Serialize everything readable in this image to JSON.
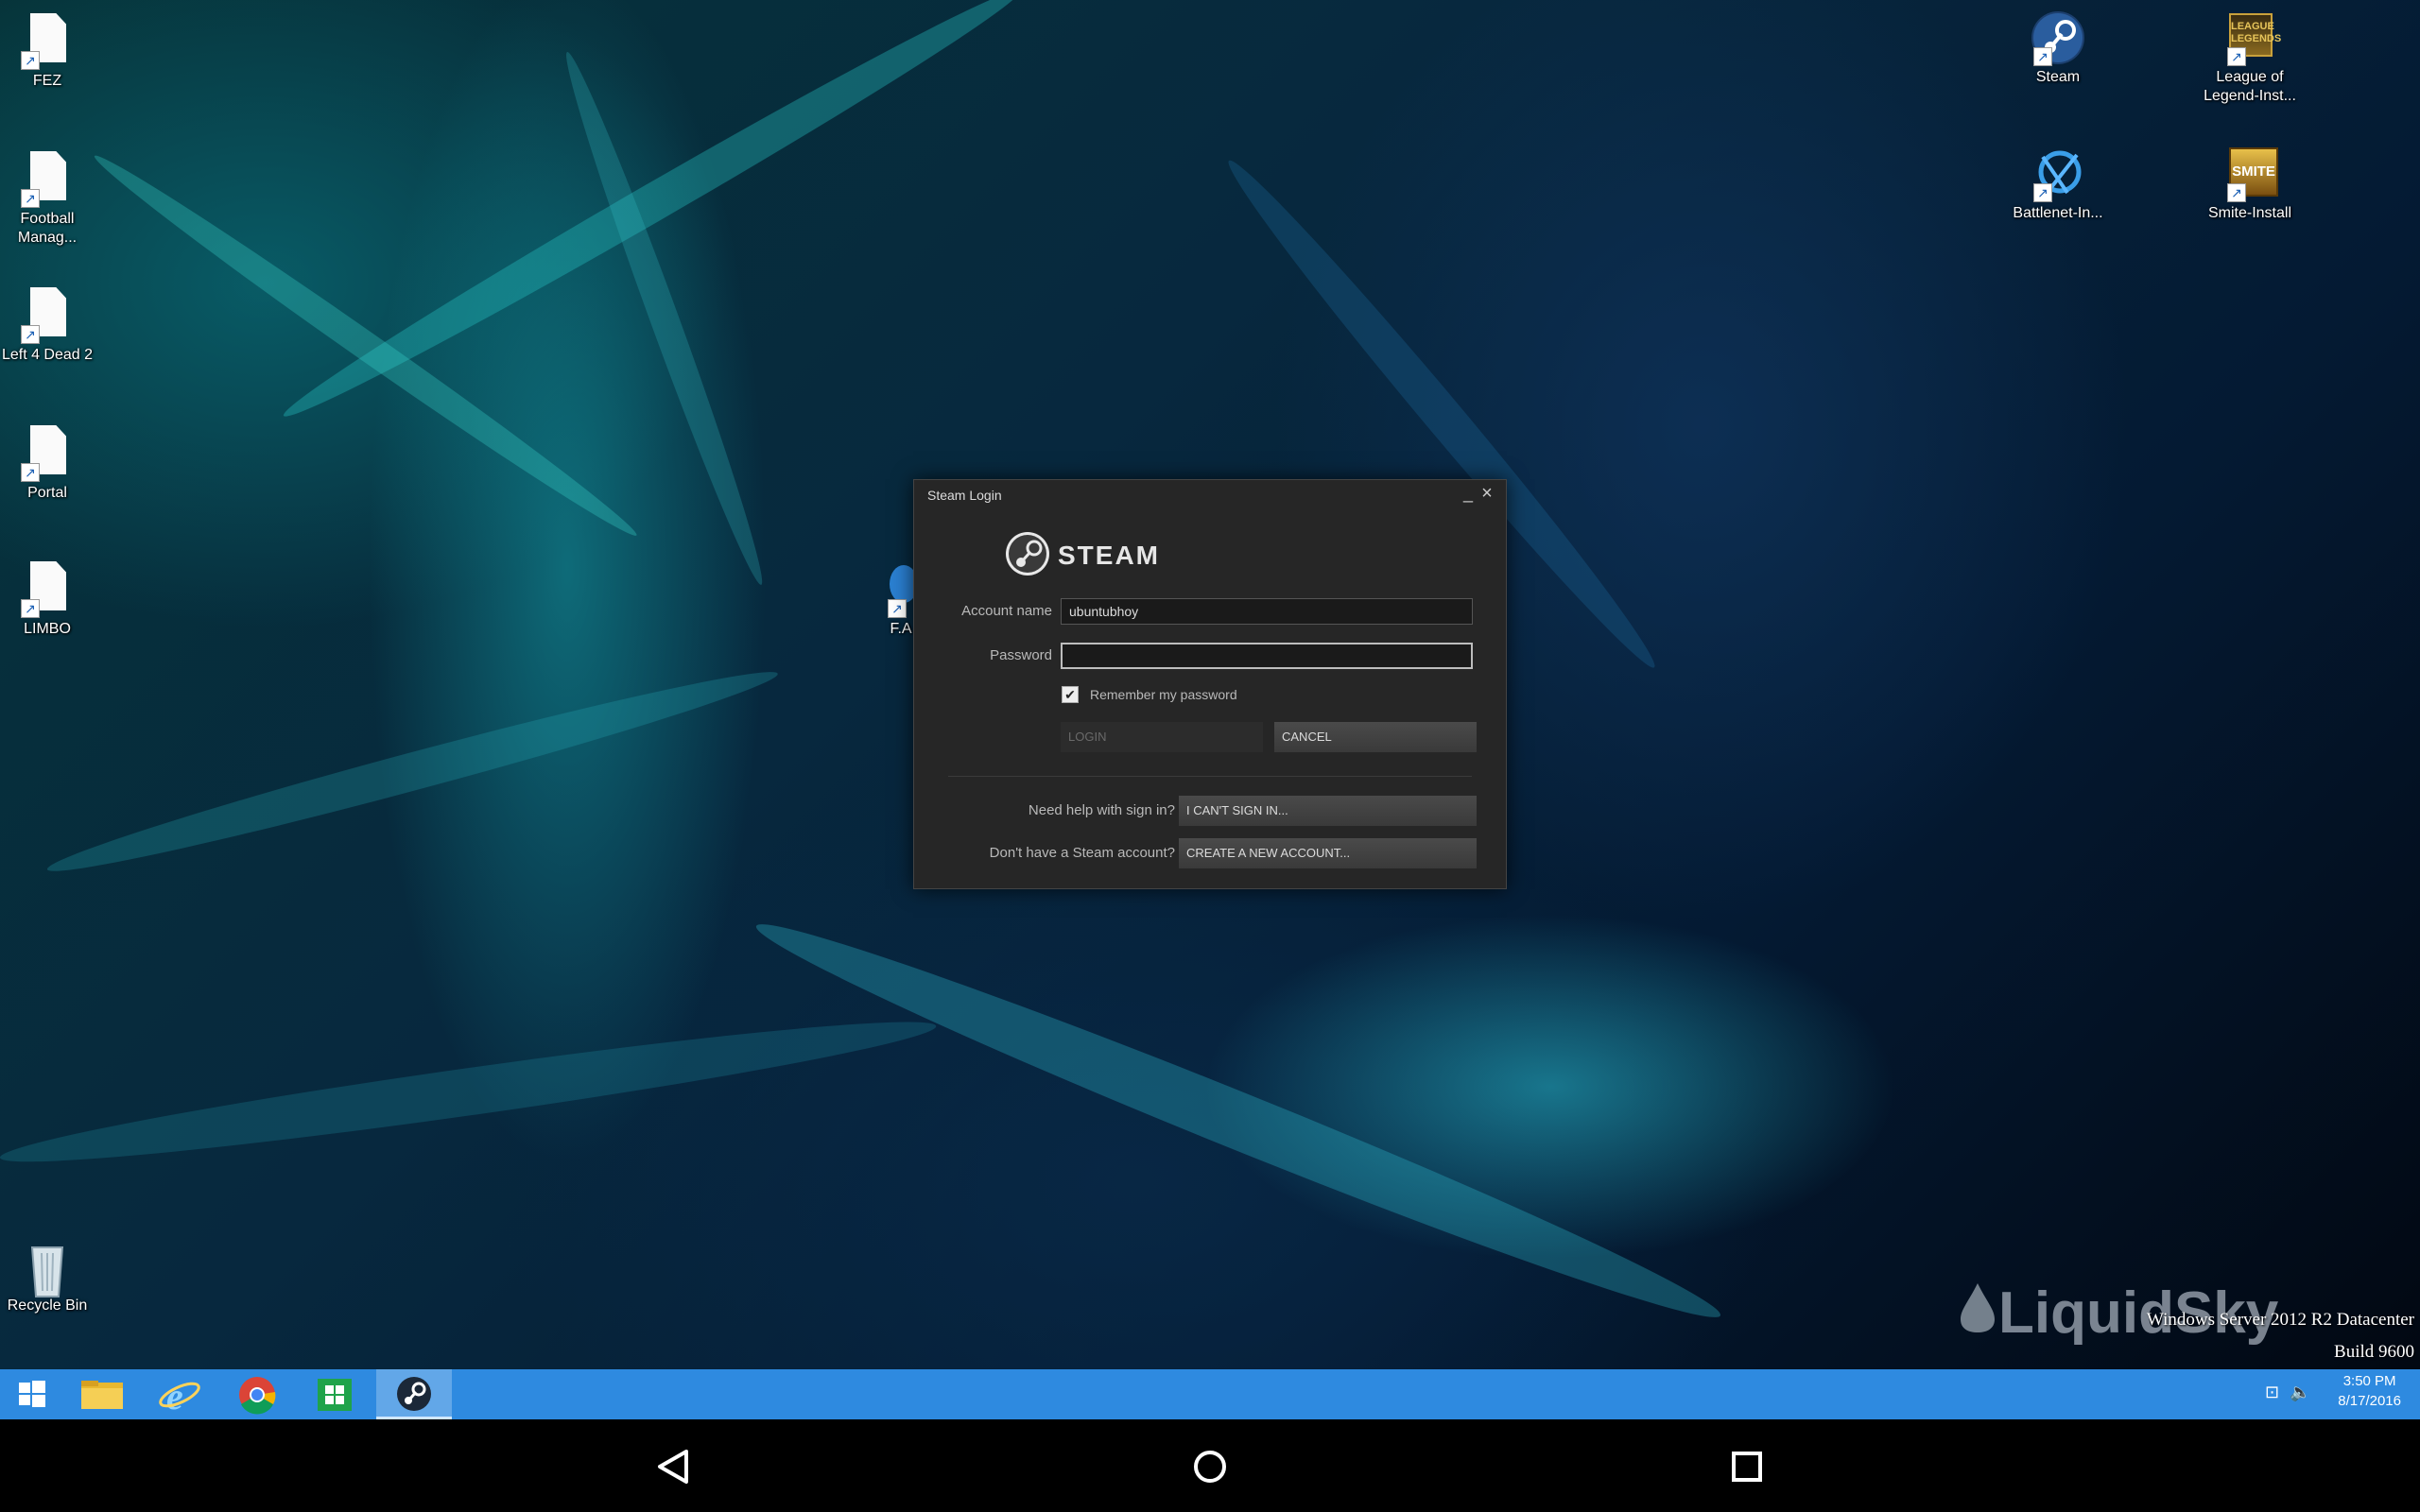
{
  "desktop": {
    "icons_left": [
      {
        "label": "FEZ"
      },
      {
        "label": "Football Manag..."
      },
      {
        "label": "Left 4 Dead 2"
      },
      {
        "label": "Portal"
      },
      {
        "label": "LIMBO"
      },
      {
        "label": "F.A"
      }
    ],
    "icons_right": [
      {
        "label": "Steam"
      },
      {
        "label": "League of Legend-Inst..."
      },
      {
        "label": "Battlenet-In..."
      },
      {
        "label": "Smite-Install"
      }
    ],
    "recycle_bin": {
      "label": "Recycle Bin"
    }
  },
  "watermark": {
    "brand": "LiquidSky",
    "os_line1": "Windows Server 2012 R2 Datacenter",
    "os_line2": "Build 9600"
  },
  "steam_login": {
    "title": "Steam Login",
    "minimize": "_",
    "close": "×",
    "logo_text": "STEAM",
    "account_label": "Account name",
    "account_value": "ubuntubhoy",
    "password_label": "Password",
    "password_value": "",
    "remember_label": "Remember my password",
    "remember_checked": true,
    "login_button": "LOGIN",
    "cancel_button": "CANCEL",
    "help_label": "Need help with sign in?",
    "help_button": "I CAN'T SIGN IN...",
    "no_account_label": "Don't have a Steam account?",
    "create_button": "CREATE A NEW ACCOUNT..."
  },
  "taskbar": {
    "apps": [
      "start",
      "file-explorer",
      "internet-explorer",
      "chrome",
      "store",
      "steam"
    ],
    "active_app": "steam",
    "time": "3:50 PM",
    "date": "8/17/2016"
  },
  "android_nav": [
    "back",
    "home",
    "recents"
  ],
  "colors": {
    "taskbar": "#2e8ae0",
    "dialog_bg": "#262626",
    "desktop_teal": "#1fb5b5"
  }
}
